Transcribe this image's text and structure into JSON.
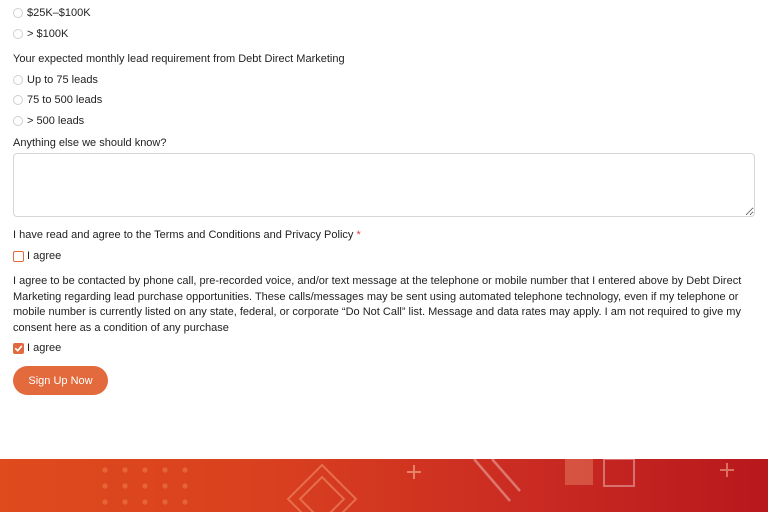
{
  "revenue_options": [
    {
      "label": "$25K–$100K",
      "selected": false
    },
    {
      "label": "> $100K",
      "selected": false
    }
  ],
  "lead_question": {
    "label": "Your expected monthly lead requirement from Debt Direct Marketing",
    "options": [
      {
        "label": "Up to 75 leads",
        "selected": false
      },
      {
        "label": "75 to 500 leads",
        "selected": false
      },
      {
        "label": "> 500 leads",
        "selected": false
      }
    ]
  },
  "anything_else": {
    "label": "Anything else we should know?",
    "value": "",
    "placeholder": ""
  },
  "terms": {
    "label": "I have read and agree to the Terms and Conditions and Privacy Policy",
    "required_mark": "*",
    "checkbox_label": "I agree",
    "checked": false
  },
  "consent": {
    "text": "I agree to be contacted by phone call, pre-recorded voice, and/or text message at the telephone or mobile number that I entered above by Debt Direct Marketing regarding lead purchase opportunities. These calls/messages may be sent using automated telephone technology, even if my telephone or mobile number is currently listed on any state, federal, or corporate “Do Not Call” list. Message and data rates may apply. I am not required to give my consent here as a condition of any purchase",
    "checkbox_label": "I agree",
    "checked": true
  },
  "submit": {
    "label": "Sign Up Now"
  },
  "colors": {
    "accent": "#e26a3c",
    "footer_start": "#df4b1d",
    "footer_end": "#b8181c"
  }
}
